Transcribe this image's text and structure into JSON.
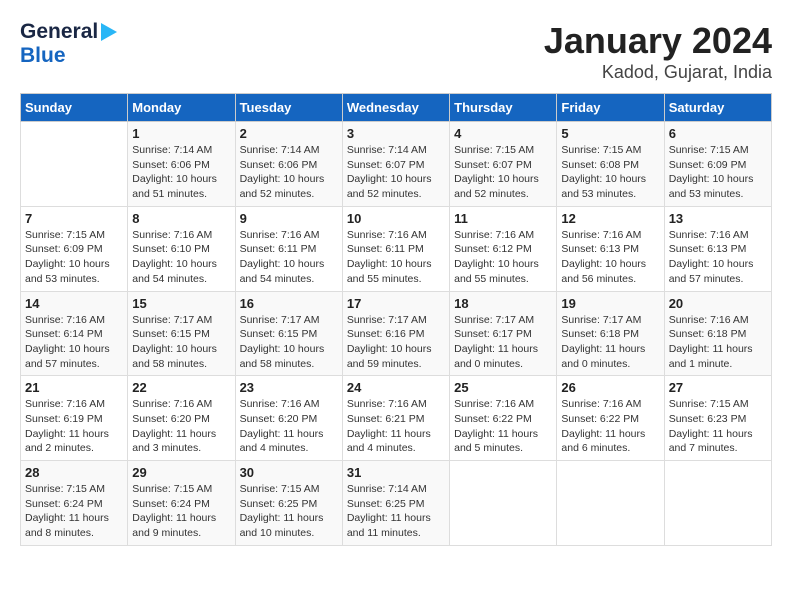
{
  "logo": {
    "line1": "General",
    "line2": "Blue"
  },
  "title": "January 2024",
  "subtitle": "Kadod, Gujarat, India",
  "headers": [
    "Sunday",
    "Monday",
    "Tuesday",
    "Wednesday",
    "Thursday",
    "Friday",
    "Saturday"
  ],
  "weeks": [
    [
      {
        "day": "",
        "info": ""
      },
      {
        "day": "1",
        "info": "Sunrise: 7:14 AM\nSunset: 6:06 PM\nDaylight: 10 hours\nand 51 minutes."
      },
      {
        "day": "2",
        "info": "Sunrise: 7:14 AM\nSunset: 6:06 PM\nDaylight: 10 hours\nand 52 minutes."
      },
      {
        "day": "3",
        "info": "Sunrise: 7:14 AM\nSunset: 6:07 PM\nDaylight: 10 hours\nand 52 minutes."
      },
      {
        "day": "4",
        "info": "Sunrise: 7:15 AM\nSunset: 6:07 PM\nDaylight: 10 hours\nand 52 minutes."
      },
      {
        "day": "5",
        "info": "Sunrise: 7:15 AM\nSunset: 6:08 PM\nDaylight: 10 hours\nand 53 minutes."
      },
      {
        "day": "6",
        "info": "Sunrise: 7:15 AM\nSunset: 6:09 PM\nDaylight: 10 hours\nand 53 minutes."
      }
    ],
    [
      {
        "day": "7",
        "info": "Sunrise: 7:15 AM\nSunset: 6:09 PM\nDaylight: 10 hours\nand 53 minutes."
      },
      {
        "day": "8",
        "info": "Sunrise: 7:16 AM\nSunset: 6:10 PM\nDaylight: 10 hours\nand 54 minutes."
      },
      {
        "day": "9",
        "info": "Sunrise: 7:16 AM\nSunset: 6:11 PM\nDaylight: 10 hours\nand 54 minutes."
      },
      {
        "day": "10",
        "info": "Sunrise: 7:16 AM\nSunset: 6:11 PM\nDaylight: 10 hours\nand 55 minutes."
      },
      {
        "day": "11",
        "info": "Sunrise: 7:16 AM\nSunset: 6:12 PM\nDaylight: 10 hours\nand 55 minutes."
      },
      {
        "day": "12",
        "info": "Sunrise: 7:16 AM\nSunset: 6:13 PM\nDaylight: 10 hours\nand 56 minutes."
      },
      {
        "day": "13",
        "info": "Sunrise: 7:16 AM\nSunset: 6:13 PM\nDaylight: 10 hours\nand 57 minutes."
      }
    ],
    [
      {
        "day": "14",
        "info": "Sunrise: 7:16 AM\nSunset: 6:14 PM\nDaylight: 10 hours\nand 57 minutes."
      },
      {
        "day": "15",
        "info": "Sunrise: 7:17 AM\nSunset: 6:15 PM\nDaylight: 10 hours\nand 58 minutes."
      },
      {
        "day": "16",
        "info": "Sunrise: 7:17 AM\nSunset: 6:15 PM\nDaylight: 10 hours\nand 58 minutes."
      },
      {
        "day": "17",
        "info": "Sunrise: 7:17 AM\nSunset: 6:16 PM\nDaylight: 10 hours\nand 59 minutes."
      },
      {
        "day": "18",
        "info": "Sunrise: 7:17 AM\nSunset: 6:17 PM\nDaylight: 11 hours\nand 0 minutes."
      },
      {
        "day": "19",
        "info": "Sunrise: 7:17 AM\nSunset: 6:18 PM\nDaylight: 11 hours\nand 0 minutes."
      },
      {
        "day": "20",
        "info": "Sunrise: 7:16 AM\nSunset: 6:18 PM\nDaylight: 11 hours\nand 1 minute."
      }
    ],
    [
      {
        "day": "21",
        "info": "Sunrise: 7:16 AM\nSunset: 6:19 PM\nDaylight: 11 hours\nand 2 minutes."
      },
      {
        "day": "22",
        "info": "Sunrise: 7:16 AM\nSunset: 6:20 PM\nDaylight: 11 hours\nand 3 minutes."
      },
      {
        "day": "23",
        "info": "Sunrise: 7:16 AM\nSunset: 6:20 PM\nDaylight: 11 hours\nand 4 minutes."
      },
      {
        "day": "24",
        "info": "Sunrise: 7:16 AM\nSunset: 6:21 PM\nDaylight: 11 hours\nand 4 minutes."
      },
      {
        "day": "25",
        "info": "Sunrise: 7:16 AM\nSunset: 6:22 PM\nDaylight: 11 hours\nand 5 minutes."
      },
      {
        "day": "26",
        "info": "Sunrise: 7:16 AM\nSunset: 6:22 PM\nDaylight: 11 hours\nand 6 minutes."
      },
      {
        "day": "27",
        "info": "Sunrise: 7:15 AM\nSunset: 6:23 PM\nDaylight: 11 hours\nand 7 minutes."
      }
    ],
    [
      {
        "day": "28",
        "info": "Sunrise: 7:15 AM\nSunset: 6:24 PM\nDaylight: 11 hours\nand 8 minutes."
      },
      {
        "day": "29",
        "info": "Sunrise: 7:15 AM\nSunset: 6:24 PM\nDaylight: 11 hours\nand 9 minutes."
      },
      {
        "day": "30",
        "info": "Sunrise: 7:15 AM\nSunset: 6:25 PM\nDaylight: 11 hours\nand 10 minutes."
      },
      {
        "day": "31",
        "info": "Sunrise: 7:14 AM\nSunset: 6:25 PM\nDaylight: 11 hours\nand 11 minutes."
      },
      {
        "day": "",
        "info": ""
      },
      {
        "day": "",
        "info": ""
      },
      {
        "day": "",
        "info": ""
      }
    ]
  ]
}
